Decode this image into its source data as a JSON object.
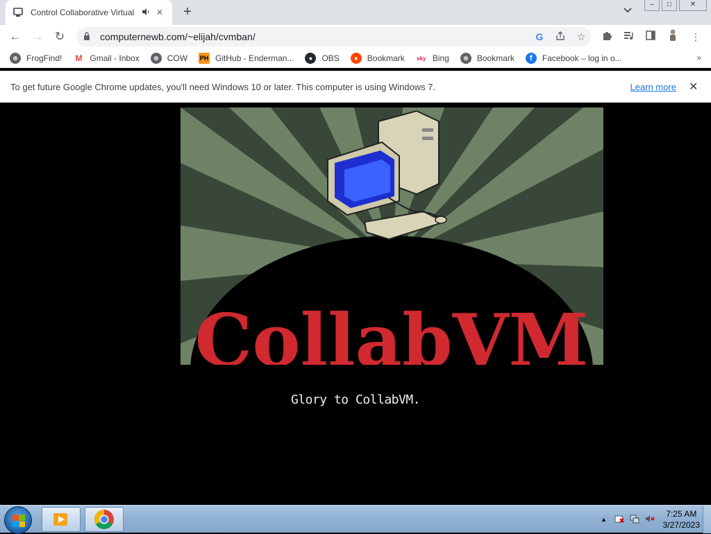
{
  "tab": {
    "title": "Control Collaborative Virtual",
    "audio_icon": "speaker-icon",
    "close": "✕"
  },
  "newtab": "+",
  "window_controls": {
    "minimize": "–",
    "maximize": "□",
    "close": "✕"
  },
  "nav": {
    "back": "←",
    "forward": "→",
    "reload": "↻"
  },
  "address": {
    "url": "computernewb.com/~elijah/cvmban/"
  },
  "bookmarks": [
    {
      "label": "FrogFind!",
      "icon": "globe-icon"
    },
    {
      "label": "Gmail - Inbox",
      "icon": "gmail-icon"
    },
    {
      "label": "COW",
      "icon": "globe-icon"
    },
    {
      "label": "GitHub - Enderman...",
      "icon": "ph-icon"
    },
    {
      "label": "OBS",
      "icon": "github-icon"
    },
    {
      "label": "Bookmark",
      "icon": "reddit-icon"
    },
    {
      "label": "Bing",
      "icon": "sky-icon"
    },
    {
      "label": "Bookmark",
      "icon": "globe-icon"
    },
    {
      "label": "Facebook – log in o...",
      "icon": "facebook-icon"
    }
  ],
  "bookmarks_more": "»",
  "infobar": {
    "message": "To get future Google Chrome updates, you'll need Windows 10 or later. This computer is using Windows 7.",
    "link": "Learn more",
    "close": "✕"
  },
  "page": {
    "logo_text": "CollabVM",
    "caption": "Glory to CollabVM."
  },
  "colors": {
    "logo_red": "#d0292f",
    "ray_dark": "#394739",
    "ray_light": "#6e8266"
  },
  "taskbar": {
    "clock_time": "7:25 AM",
    "clock_date": "3/27/2023",
    "tray_expand": "▲"
  }
}
